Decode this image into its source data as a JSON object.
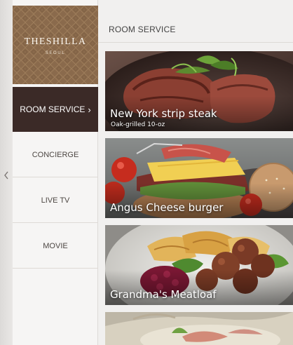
{
  "brand": {
    "name": "THESHILLA",
    "location": "SEOUL"
  },
  "nav": {
    "back_icon": "chevron-left-icon",
    "items": [
      {
        "label": "ROOM SERVICE",
        "active": true,
        "chevron": "›"
      },
      {
        "label": "CONCIERGE",
        "active": false
      },
      {
        "label": "LIVE TV",
        "active": false
      },
      {
        "label": "MOVIE",
        "active": false
      }
    ]
  },
  "page": {
    "title": "ROOM SERVICE"
  },
  "menu": [
    {
      "name": "New York strip steak",
      "description": "Oak-grilled 10-oz"
    },
    {
      "name": "Angus Cheese burger",
      "description": ""
    },
    {
      "name": "Grandma's Meatloaf",
      "description": ""
    },
    {
      "name": "",
      "description": ""
    }
  ],
  "colors": {
    "active_nav": "#3b2a27",
    "logo_bg": "#8a6a4c"
  }
}
